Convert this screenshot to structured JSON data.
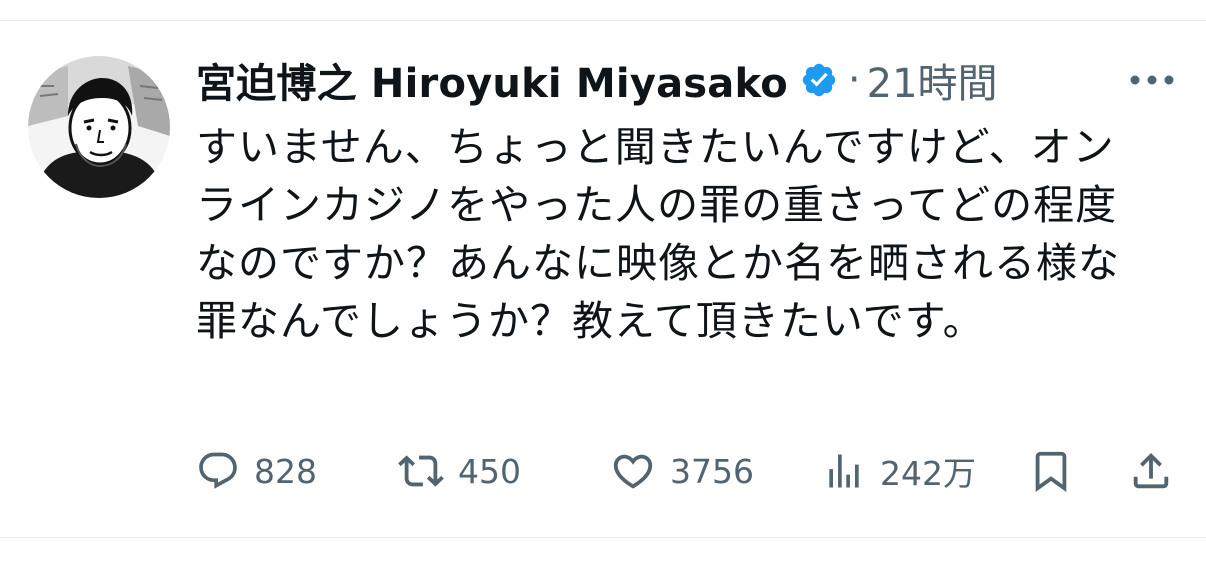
{
  "tweet": {
    "display_name": "宮迫博之 Hiroyuki Miyasako",
    "separator": "·",
    "timestamp": "21時間",
    "verified_icon": "verified-badge-icon",
    "text": "すいません、ちょっと聞きたいんですけど、オンラインカジノをやった人の罪の重さってどの程度なのですか？あんなに映像とか名を晒される様な罪なんでしょうか？教えて頂きたいです。"
  },
  "actions": {
    "replies": {
      "icon": "reply-icon",
      "count": "828"
    },
    "retweets": {
      "icon": "retweet-icon",
      "count": "450"
    },
    "likes": {
      "icon": "heart-icon",
      "count": "3756"
    },
    "views": {
      "icon": "analytics-icon",
      "count": "242万"
    },
    "bookmark": {
      "icon": "bookmark-icon"
    },
    "share": {
      "icon": "share-icon"
    }
  },
  "colors": {
    "text": "#0f1419",
    "secondary": "#536471",
    "verified": "#1d9bf0",
    "divider": "#e6e9ec"
  }
}
